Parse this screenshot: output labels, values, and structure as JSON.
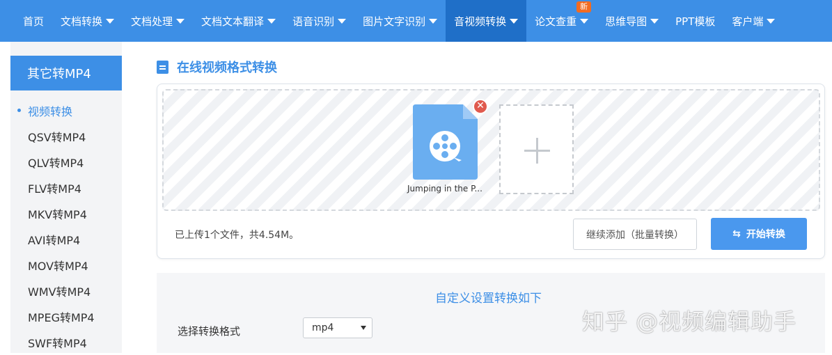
{
  "nav": {
    "items": [
      {
        "label": "首页",
        "caret": false,
        "active": false
      },
      {
        "label": "文档转换",
        "caret": true,
        "active": false
      },
      {
        "label": "文档处理",
        "caret": true,
        "active": false
      },
      {
        "label": "文档文本翻译",
        "caret": true,
        "active": false
      },
      {
        "label": "语音识别",
        "caret": true,
        "active": false
      },
      {
        "label": "图片文字识别",
        "caret": true,
        "active": false
      },
      {
        "label": "音视频转换",
        "caret": true,
        "active": true
      },
      {
        "label": "论文查重",
        "caret": true,
        "active": false,
        "badge": "新"
      },
      {
        "label": "思维导图",
        "caret": true,
        "active": false
      },
      {
        "label": "PPT模板",
        "caret": false,
        "active": false
      },
      {
        "label": "客户端",
        "caret": true,
        "active": false
      }
    ],
    "colors": {
      "bar": "#3d8fe6",
      "active": "#1f6fc8",
      "badge": "#f26b21"
    }
  },
  "sidebar": {
    "title": "其它转MP4",
    "items": [
      {
        "label": "视频转换",
        "active": true
      },
      {
        "label": "QSV转MP4",
        "active": false
      },
      {
        "label": "QLV转MP4",
        "active": false
      },
      {
        "label": "FLV转MP4",
        "active": false
      },
      {
        "label": "MKV转MP4",
        "active": false
      },
      {
        "label": "AVI转MP4",
        "active": false
      },
      {
        "label": "MOV转MP4",
        "active": false
      },
      {
        "label": "WMV转MP4",
        "active": false
      },
      {
        "label": "MPEG转MP4",
        "active": false
      },
      {
        "label": "SWF转MP4",
        "active": false
      }
    ]
  },
  "main": {
    "section_title": "在线视频格式转换",
    "file": {
      "name": "Jumping in the P...",
      "icon": "video-file-icon",
      "remove_icon": "close-icon"
    },
    "add_tile_icon": "plus-icon",
    "upload_status": "已上传1个文件，共4.54M。",
    "add_more_label": "继续添加（批量转换）",
    "start_label": "开始转换",
    "start_icon": "swap-arrows-icon"
  },
  "settings": {
    "title": "自定义设置转换如下",
    "format_label": "选择转换格式",
    "format_value": "mp4"
  },
  "watermark": "知乎 @视频编辑助手"
}
